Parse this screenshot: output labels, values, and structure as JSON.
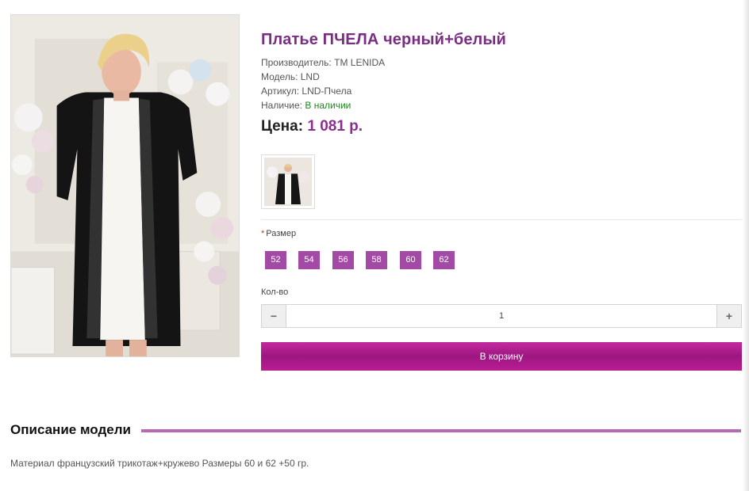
{
  "product": {
    "title": "Платье ПЧЕЛА черный+белый",
    "manufacturer_label": "Производитель:",
    "manufacturer_value": "TM LENIDA",
    "model_label": "Модель:",
    "model_value": "LND",
    "sku_label": "Артикул:",
    "sku_value": "LND-Пчела",
    "availability_label": "Наличие:",
    "availability_value": "В наличии",
    "price_label": "Цена:",
    "price_value": "1 081 р."
  },
  "options": {
    "size_required_mark": "*",
    "size_label": "Размер",
    "sizes": [
      "52",
      "54",
      "56",
      "58",
      "60",
      "62"
    ]
  },
  "quantity": {
    "label": "Кол-во",
    "minus": "−",
    "plus": "+",
    "value": "1"
  },
  "cart": {
    "button_label": "В корзину"
  },
  "description": {
    "heading": "Описание модели",
    "text": "Материал французский трикотаж+кружево Размеры 60 и 62 +50 гр."
  },
  "colors": {
    "title": "#7b2d84",
    "price": "#8b2d8f",
    "size_button": "#a24aa6",
    "cart_button": "#b01e8e",
    "in_stock": "#1a8a1a",
    "section_line": "#b26bb5"
  }
}
